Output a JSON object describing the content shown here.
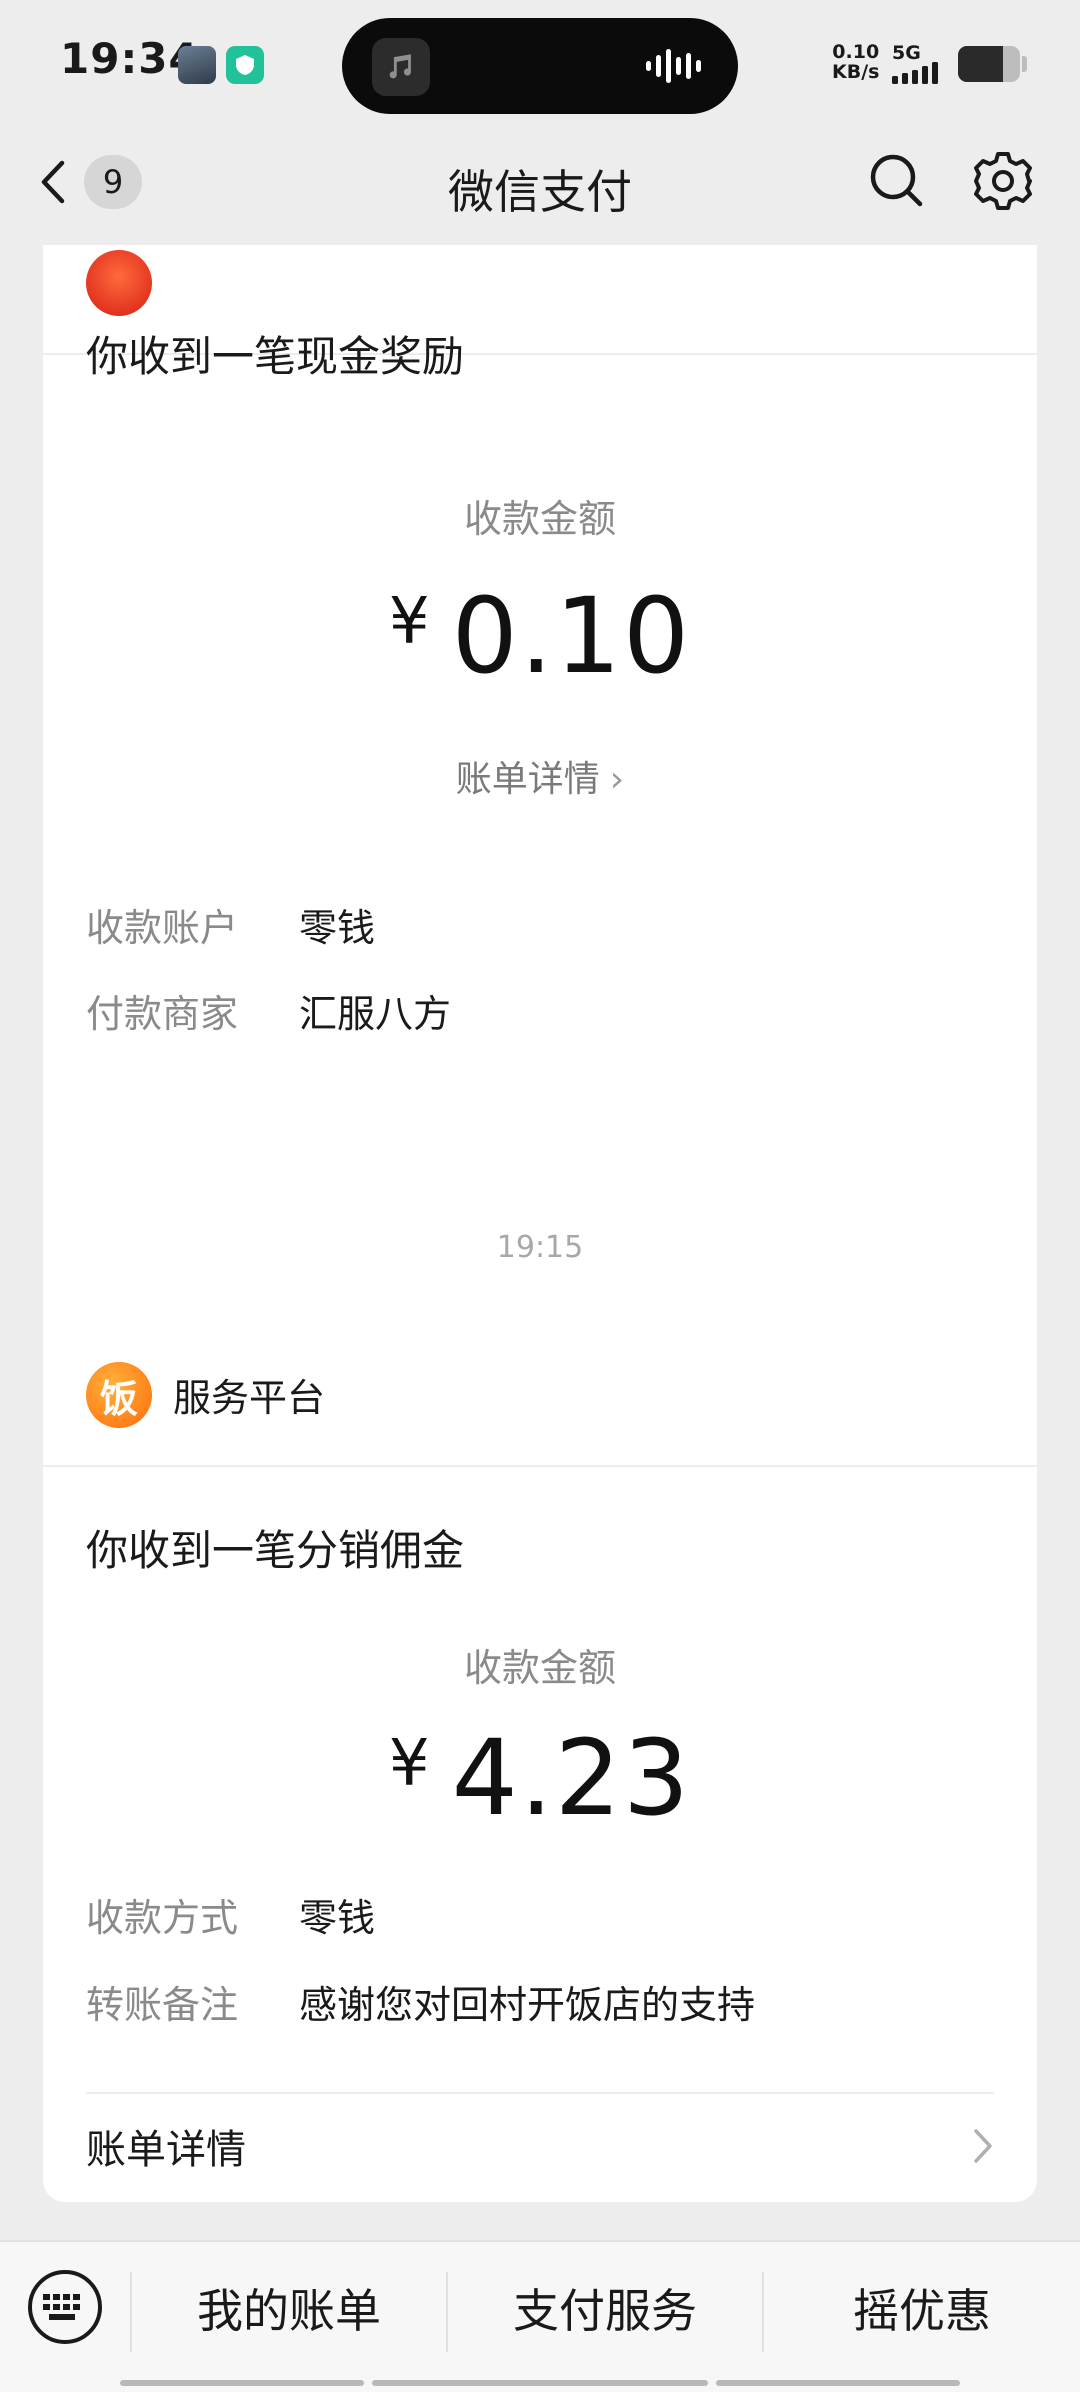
{
  "status_bar": {
    "time": "19:34",
    "net_speed_value": "0.10",
    "net_speed_unit": "KB/s",
    "network": "5G",
    "battery_level": 0.72
  },
  "nav": {
    "back_icon": "chevron-left-icon",
    "unread_count": "9",
    "title": "微信支付",
    "search_icon": "search-icon",
    "settings_icon": "gear-icon"
  },
  "messages": [
    {
      "title": "你收到一笔现金奖励",
      "amount_label": "收款金额",
      "currency": "¥",
      "amount": "0.10",
      "bill_link": "账单详情",
      "rows": [
        {
          "label": "收款账户",
          "value": "零钱"
        },
        {
          "label": "付款商家",
          "value": "汇服八方"
        }
      ]
    },
    {
      "timestamp": "19:15",
      "merchant_logo_char": "饭",
      "merchant_name": "服务平台",
      "title": "你收到一笔分销佣金",
      "amount_label": "收款金额",
      "currency": "¥",
      "amount": "4.23",
      "rows": [
        {
          "label": "收款方式",
          "value": "零钱"
        },
        {
          "label": "转账备注",
          "value": "感谢您对回村开饭店的支持"
        }
      ],
      "bill_link": "账单详情"
    }
  ],
  "bottom_menu": {
    "keyboard_icon": "keyboard-icon",
    "items": [
      "我的账单",
      "支付服务",
      "摇优惠"
    ]
  }
}
